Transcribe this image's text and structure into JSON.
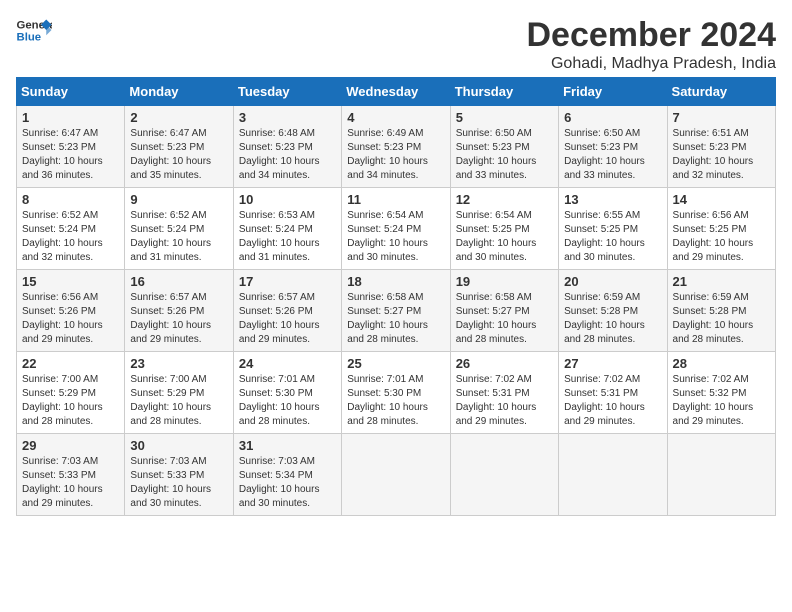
{
  "logo": {
    "line1": "General",
    "line2": "Blue"
  },
  "title": "December 2024",
  "location": "Gohadi, Madhya Pradesh, India",
  "headers": [
    "Sunday",
    "Monday",
    "Tuesday",
    "Wednesday",
    "Thursday",
    "Friday",
    "Saturday"
  ],
  "weeks": [
    [
      {
        "day": "1",
        "lines": [
          "Sunrise: 6:47 AM",
          "Sunset: 5:23 PM",
          "Daylight: 10 hours",
          "and 36 minutes."
        ]
      },
      {
        "day": "2",
        "lines": [
          "Sunrise: 6:47 AM",
          "Sunset: 5:23 PM",
          "Daylight: 10 hours",
          "and 35 minutes."
        ]
      },
      {
        "day": "3",
        "lines": [
          "Sunrise: 6:48 AM",
          "Sunset: 5:23 PM",
          "Daylight: 10 hours",
          "and 34 minutes."
        ]
      },
      {
        "day": "4",
        "lines": [
          "Sunrise: 6:49 AM",
          "Sunset: 5:23 PM",
          "Daylight: 10 hours",
          "and 34 minutes."
        ]
      },
      {
        "day": "5",
        "lines": [
          "Sunrise: 6:50 AM",
          "Sunset: 5:23 PM",
          "Daylight: 10 hours",
          "and 33 minutes."
        ]
      },
      {
        "day": "6",
        "lines": [
          "Sunrise: 6:50 AM",
          "Sunset: 5:23 PM",
          "Daylight: 10 hours",
          "and 33 minutes."
        ]
      },
      {
        "day": "7",
        "lines": [
          "Sunrise: 6:51 AM",
          "Sunset: 5:23 PM",
          "Daylight: 10 hours",
          "and 32 minutes."
        ]
      }
    ],
    [
      {
        "day": "8",
        "lines": [
          "Sunrise: 6:52 AM",
          "Sunset: 5:24 PM",
          "Daylight: 10 hours",
          "and 32 minutes."
        ]
      },
      {
        "day": "9",
        "lines": [
          "Sunrise: 6:52 AM",
          "Sunset: 5:24 PM",
          "Daylight: 10 hours",
          "and 31 minutes."
        ]
      },
      {
        "day": "10",
        "lines": [
          "Sunrise: 6:53 AM",
          "Sunset: 5:24 PM",
          "Daylight: 10 hours",
          "and 31 minutes."
        ]
      },
      {
        "day": "11",
        "lines": [
          "Sunrise: 6:54 AM",
          "Sunset: 5:24 PM",
          "Daylight: 10 hours",
          "and 30 minutes."
        ]
      },
      {
        "day": "12",
        "lines": [
          "Sunrise: 6:54 AM",
          "Sunset: 5:25 PM",
          "Daylight: 10 hours",
          "and 30 minutes."
        ]
      },
      {
        "day": "13",
        "lines": [
          "Sunrise: 6:55 AM",
          "Sunset: 5:25 PM",
          "Daylight: 10 hours",
          "and 30 minutes."
        ]
      },
      {
        "day": "14",
        "lines": [
          "Sunrise: 6:56 AM",
          "Sunset: 5:25 PM",
          "Daylight: 10 hours",
          "and 29 minutes."
        ]
      }
    ],
    [
      {
        "day": "15",
        "lines": [
          "Sunrise: 6:56 AM",
          "Sunset: 5:26 PM",
          "Daylight: 10 hours",
          "and 29 minutes."
        ]
      },
      {
        "day": "16",
        "lines": [
          "Sunrise: 6:57 AM",
          "Sunset: 5:26 PM",
          "Daylight: 10 hours",
          "and 29 minutes."
        ]
      },
      {
        "day": "17",
        "lines": [
          "Sunrise: 6:57 AM",
          "Sunset: 5:26 PM",
          "Daylight: 10 hours",
          "and 29 minutes."
        ]
      },
      {
        "day": "18",
        "lines": [
          "Sunrise: 6:58 AM",
          "Sunset: 5:27 PM",
          "Daylight: 10 hours",
          "and 28 minutes."
        ]
      },
      {
        "day": "19",
        "lines": [
          "Sunrise: 6:58 AM",
          "Sunset: 5:27 PM",
          "Daylight: 10 hours",
          "and 28 minutes."
        ]
      },
      {
        "day": "20",
        "lines": [
          "Sunrise: 6:59 AM",
          "Sunset: 5:28 PM",
          "Daylight: 10 hours",
          "and 28 minutes."
        ]
      },
      {
        "day": "21",
        "lines": [
          "Sunrise: 6:59 AM",
          "Sunset: 5:28 PM",
          "Daylight: 10 hours",
          "and 28 minutes."
        ]
      }
    ],
    [
      {
        "day": "22",
        "lines": [
          "Sunrise: 7:00 AM",
          "Sunset: 5:29 PM",
          "Daylight: 10 hours",
          "and 28 minutes."
        ]
      },
      {
        "day": "23",
        "lines": [
          "Sunrise: 7:00 AM",
          "Sunset: 5:29 PM",
          "Daylight: 10 hours",
          "and 28 minutes."
        ]
      },
      {
        "day": "24",
        "lines": [
          "Sunrise: 7:01 AM",
          "Sunset: 5:30 PM",
          "Daylight: 10 hours",
          "and 28 minutes."
        ]
      },
      {
        "day": "25",
        "lines": [
          "Sunrise: 7:01 AM",
          "Sunset: 5:30 PM",
          "Daylight: 10 hours",
          "and 28 minutes."
        ]
      },
      {
        "day": "26",
        "lines": [
          "Sunrise: 7:02 AM",
          "Sunset: 5:31 PM",
          "Daylight: 10 hours",
          "and 29 minutes."
        ]
      },
      {
        "day": "27",
        "lines": [
          "Sunrise: 7:02 AM",
          "Sunset: 5:31 PM",
          "Daylight: 10 hours",
          "and 29 minutes."
        ]
      },
      {
        "day": "28",
        "lines": [
          "Sunrise: 7:02 AM",
          "Sunset: 5:32 PM",
          "Daylight: 10 hours",
          "and 29 minutes."
        ]
      }
    ],
    [
      {
        "day": "29",
        "lines": [
          "Sunrise: 7:03 AM",
          "Sunset: 5:33 PM",
          "Daylight: 10 hours",
          "and 29 minutes."
        ]
      },
      {
        "day": "30",
        "lines": [
          "Sunrise: 7:03 AM",
          "Sunset: 5:33 PM",
          "Daylight: 10 hours",
          "and 30 minutes."
        ]
      },
      {
        "day": "31",
        "lines": [
          "Sunrise: 7:03 AM",
          "Sunset: 5:34 PM",
          "Daylight: 10 hours",
          "and 30 minutes."
        ]
      },
      {
        "day": "",
        "lines": []
      },
      {
        "day": "",
        "lines": []
      },
      {
        "day": "",
        "lines": []
      },
      {
        "day": "",
        "lines": []
      }
    ]
  ]
}
